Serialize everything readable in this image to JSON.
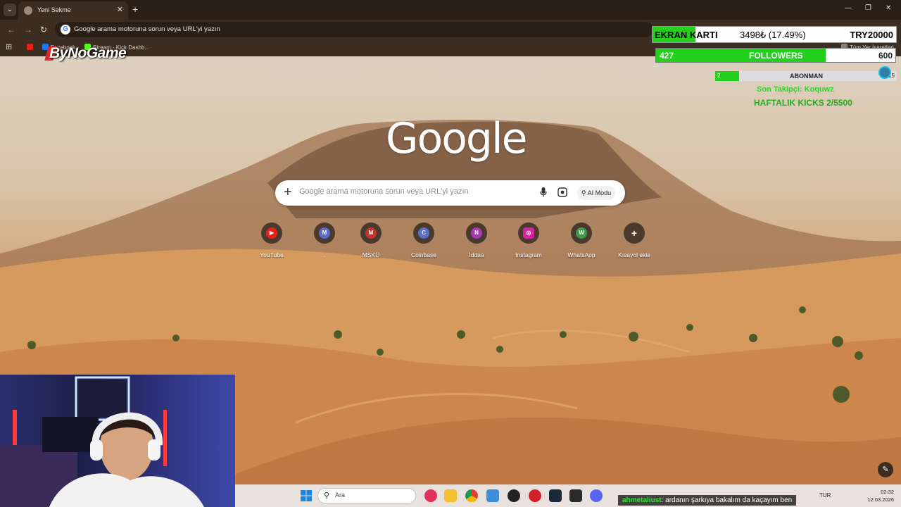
{
  "browser": {
    "tab_title": "Yeni Sekme",
    "address_text": "Google arama motoruna sorun veya URL'yi yazın",
    "bookmarks": [
      "Facebook",
      "Stream - Kick Dashb...",
      "Tüm Yer İşaretleri"
    ],
    "new_tab_symbol": "+",
    "window_controls": [
      "—",
      "❐",
      "✕"
    ]
  },
  "overlay_logo": "ByNoGame",
  "google": {
    "logo_text": "Google",
    "search_placeholder": "Google arama motoruna sorun veya URL'yi yazın",
    "ai_mode_label": "AI Modu",
    "shortcuts": [
      {
        "label": "YouTube",
        "glyph": "▶",
        "color": "#e62117"
      },
      {
        "label": ".",
        "glyph": "M",
        "color": "#5b6dc8"
      },
      {
        "label": "MSKÜ",
        "glyph": "M",
        "color": "#c0362c"
      },
      {
        "label": "Coinbase",
        "glyph": "C",
        "color": "#5b6dc8"
      },
      {
        "label": "İddaa",
        "glyph": "N",
        "color": "#a53bb5"
      },
      {
        "label": "Instagram",
        "glyph": "◎",
        "color": "#d6249f"
      },
      {
        "label": "WhatsApp",
        "glyph": "W",
        "color": "#3f9b4c"
      },
      {
        "label": "Kısayol ekle",
        "glyph": "+",
        "color": "#4a3a2e"
      }
    ]
  },
  "stream": {
    "ekran": {
      "label": "EKRAN KARTI",
      "current": "3498₺ (17.49%)",
      "target": "TRY20000",
      "progress": 0.1749
    },
    "followers": {
      "count": "427",
      "label": "FOLLOWERS",
      "goal": "600",
      "progress": 0.71
    },
    "abonman": {
      "count": "2",
      "label": "ABONMAN",
      "goal": "15",
      "progress": 0.13
    },
    "last_follower": "Son Takipçi: Koquwz",
    "kicks": "HAFTALIK KICKS 2/5500"
  },
  "taskbar": {
    "search_label": "Ara",
    "language": "TUR",
    "time": "02:32",
    "date": "12.03.2026"
  },
  "chat": {
    "user": "ahmetaliust",
    "message": ": ardanın şarkıya bakalım da kaçayım ben"
  },
  "colors": {
    "accent_green": "#23d11d",
    "chrome_dark": "#3b2d22"
  }
}
